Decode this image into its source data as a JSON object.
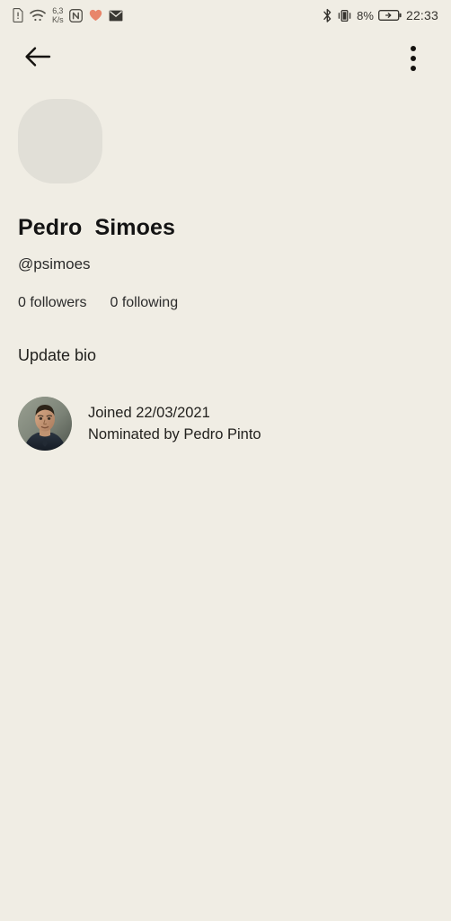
{
  "colors": {
    "background": "#f0ede4",
    "text_primary": "#1a1a1a",
    "text_secondary": "#2b2b2b",
    "avatar_placeholder": "#e1dfd7",
    "heart_icon": "#e8866b",
    "status_icon": "#53514a"
  },
  "status_bar": {
    "icons_left": [
      "sim-alert-icon",
      "wifi-icon",
      "nfc-icon",
      "heart-icon",
      "mail-icon"
    ],
    "network_speed_value": "6,3",
    "network_speed_unit": "K/s",
    "icons_right": [
      "bluetooth-icon",
      "vibrate-icon",
      "battery-charging-icon"
    ],
    "battery_percent": "8%",
    "clock": "22:33"
  },
  "app_bar": {
    "back_label": "back-arrow",
    "overflow_label": "more-options"
  },
  "profile": {
    "avatar": "empty-avatar-placeholder",
    "display_name": "Pedro  Simoes",
    "handle": "@psimoes",
    "followers": "0 followers",
    "following": "0 following",
    "update_bio": "Update bio"
  },
  "meta": {
    "avatar": "nominator-photo",
    "joined": "Joined 22/03/2021",
    "nominated_by": "Nominated by Pedro Pinto"
  }
}
